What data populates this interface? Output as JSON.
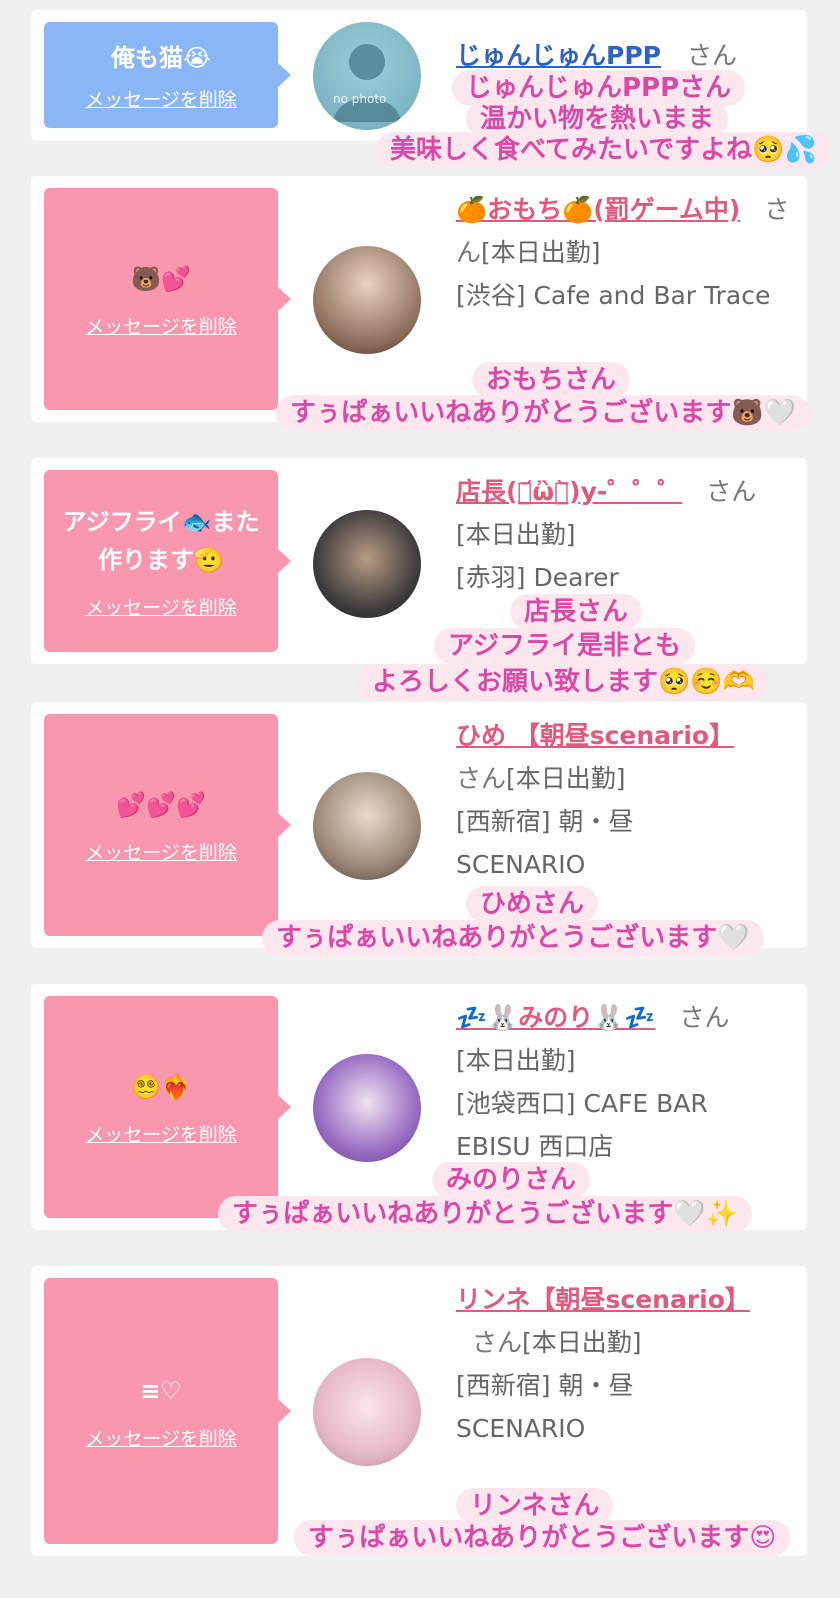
{
  "delete_label": "メッセージを削除",
  "san_label": "さん",
  "colors": {
    "blue_bubble": "#8bb6f5",
    "pink_bubble": "#f897ad",
    "name_pink": "#e05a7e",
    "name_blue": "#2f63c0",
    "caption_text": "#d74aa8"
  },
  "cards": [
    {
      "message": "俺も猫😭",
      "name": "じゅんじゅんPPP",
      "suffix": "",
      "detail1": "",
      "detail2": "",
      "avatar_text": "no photo",
      "caption_lines": [
        "じゅんじゅんPPPさん",
        "温かい物を熱いまま",
        "美味しく食べてみたいですよね🥺💦"
      ]
    },
    {
      "message": "🐻💕",
      "name": "🍊おもち🍊(罰ゲーム中)",
      "suffix": "[本日出勤]",
      "detail1": "[渋谷] Cafe and Bar Trace",
      "detail2": "",
      "avatar_text": "",
      "caption_lines": [
        "おもちさん",
        "すぅぱぁいいねありがとうございます🐻🤍"
      ]
    },
    {
      "message": "アジフライ🐟また作ります🫡",
      "name": "店長(・᷄ὢ・᷅)y-゜゜゜",
      "suffix": "[本日出勤]",
      "detail1": "[赤羽] Dearer",
      "detail2": "",
      "avatar_text": "",
      "caption_lines": [
        "店長さん",
        "アジフライ是非とも",
        "よろしくお願い致します🥺☺️🫶"
      ]
    },
    {
      "message": "💕💕💕",
      "name": "ひめ 【朝昼scenario】",
      "suffix": "[本日出勤]",
      "detail1": "[西新宿] 朝・昼 SCENARIO",
      "detail2": "",
      "avatar_text": "",
      "caption_lines": [
        "ひめさん",
        "すぅぱぁいいねありがとうございます🤍"
      ]
    },
    {
      "message": "😵‍💫❤️‍🔥",
      "name": "💤🐰みのり🐰💤",
      "suffix": "[本日出勤]",
      "detail1": "[池袋西口] CAFE BAR EBISU 西口店",
      "detail2": "",
      "avatar_text": "",
      "caption_lines": [
        "みのりさん",
        "すぅぱぁいいねありがとうございます🤍✨"
      ]
    },
    {
      "message": "≡♡",
      "name": "リンネ【朝昼scenario】",
      "suffix": "[本日出勤]",
      "detail1": "[西新宿] 朝・昼 SCENARIO",
      "detail2": "",
      "avatar_text": "",
      "caption_lines": [
        "リンネさん",
        "すぅぱぁいいねありがとうございます😍"
      ]
    }
  ]
}
